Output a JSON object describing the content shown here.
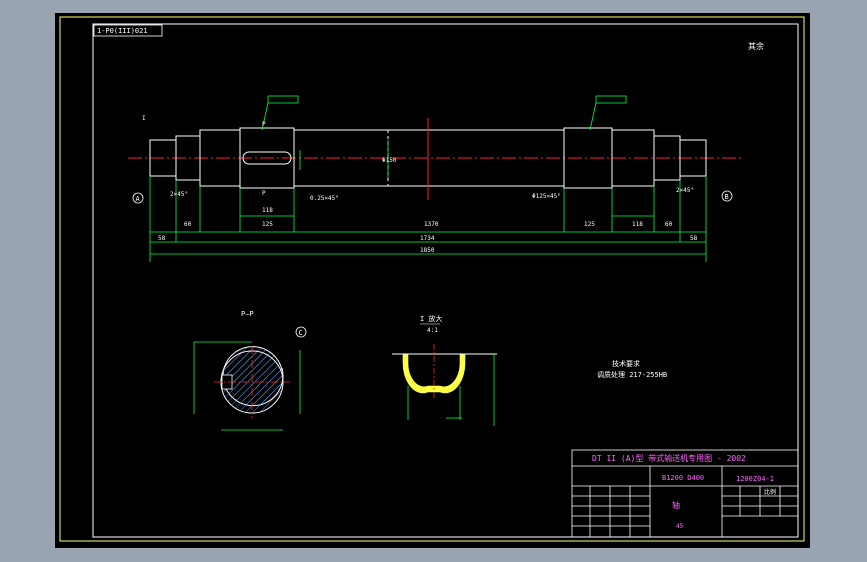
{
  "drawing_number_box": "1-P0(III)021",
  "corner_note": "其余",
  "detail_labels": {
    "section_view": "P—P",
    "zoom_view": "I 放大",
    "zoom_scale": "4:1",
    "ref_A": "A",
    "ref_B": "B",
    "ref_C": "C",
    "tag_I": "I",
    "tag_P1": "P",
    "tag_P2": "P"
  },
  "main_dimensions": {
    "d1": "58",
    "d2": "60",
    "d3": "125",
    "d4": "118",
    "d5": "1370",
    "d6": "125",
    "d7": "118",
    "d8": "60",
    "d9": "58",
    "d10": "1734",
    "d11": "1850",
    "dia_center": "Φ150",
    "chamfer_left": "2×45°",
    "chamfer_right": "2×45°",
    "tolerance_left": "0.25×45°",
    "tolerance_right": "Φ125×45°"
  },
  "material_note": {
    "title": "技术要求",
    "line1": "调质处理 217-255HB"
  },
  "title_block": {
    "title": "DT II (A)型  带式输送机专用图 - 2002",
    "code": "B1200 D400",
    "drawing_no": "1200Z04-1",
    "part_name": "轴",
    "scale_label": "比例",
    "material": "45"
  }
}
